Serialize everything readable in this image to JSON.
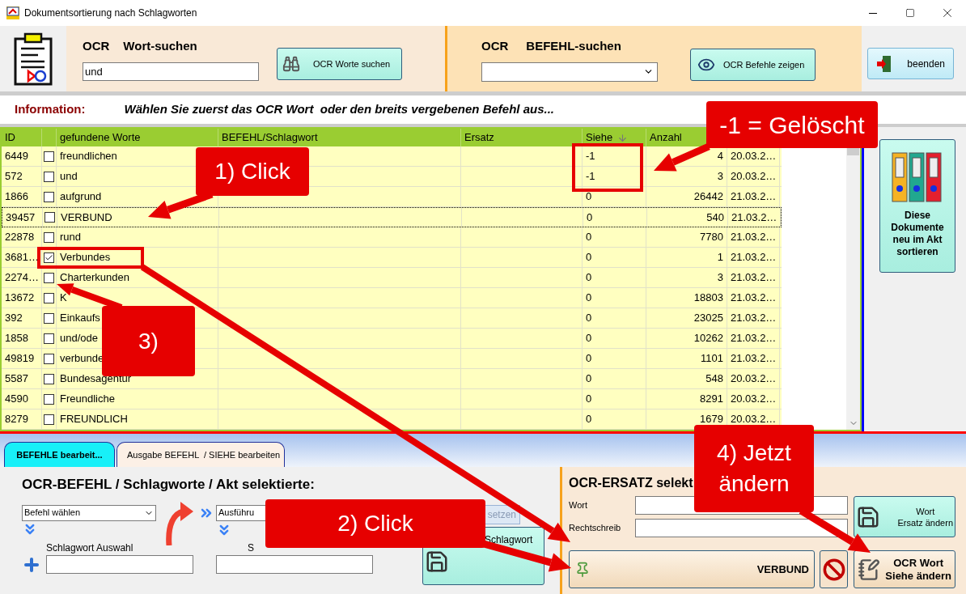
{
  "window": {
    "title": "Dokumentsortierung nach Schlagworten"
  },
  "word_search": {
    "prefix": "OCR",
    "label": "Wort-suchen",
    "value": "und",
    "button": "OCR Worte suchen"
  },
  "command_search": {
    "prefix": "OCR",
    "label": "BEFEHL-suchen",
    "button": "OCR Befehle zeigen"
  },
  "exit_button": "beenden",
  "info": {
    "label": "Information:",
    "message": "Wählen Sie zuerst das OCR Wort  oder den breits vergebenen Befehl aus..."
  },
  "table": {
    "columns": [
      {
        "label": "ID",
        "sorted": false
      },
      {
        "label": "gefundene Worte",
        "sorted": false
      },
      {
        "label": "BEFEHL/Schlagwort",
        "sorted": false
      },
      {
        "label": "Ersatz",
        "sorted": false
      },
      {
        "label": "Siehe",
        "sorted": true
      },
      {
        "label": "Anzahl",
        "sorted": false
      }
    ],
    "rows": [
      {
        "id": "6449",
        "word": "freundlichen",
        "checked": false,
        "selected": false,
        "siehe": "-1",
        "anzahl": "4",
        "date": "20.03.2…"
      },
      {
        "id": "572",
        "word": "und",
        "checked": false,
        "selected": false,
        "siehe": "-1",
        "anzahl": "3",
        "date": "20.03.2…"
      },
      {
        "id": "1866",
        "word": "aufgrund",
        "checked": false,
        "selected": false,
        "siehe": "0",
        "anzahl": "26442",
        "date": "21.03.2…"
      },
      {
        "id": "39457",
        "word": "VERBUND",
        "checked": false,
        "selected": true,
        "siehe": "0",
        "anzahl": "540",
        "date": "21.03.2…"
      },
      {
        "id": "22878",
        "word": "rund",
        "checked": false,
        "selected": false,
        "siehe": "0",
        "anzahl": "7780",
        "date": "21.03.2…"
      },
      {
        "id": "3681…",
        "word": "Verbundes",
        "checked": true,
        "selected": false,
        "siehe": "0",
        "anzahl": "1",
        "date": "21.03.2…"
      },
      {
        "id": "2274…",
        "word": "Charterkunden",
        "checked": false,
        "selected": false,
        "siehe": "0",
        "anzahl": "3",
        "date": "21.03.2…"
      },
      {
        "id": "13672",
        "word": "K",
        "checked": false,
        "selected": false,
        "siehe": "0",
        "anzahl": "18803",
        "date": "21.03.2…"
      },
      {
        "id": "392",
        "word": "Einkaufs",
        "checked": false,
        "selected": false,
        "siehe": "0",
        "anzahl": "23025",
        "date": "21.03.2…"
      },
      {
        "id": "1858",
        "word": "und/ode",
        "checked": false,
        "selected": false,
        "siehe": "0",
        "anzahl": "10262",
        "date": "21.03.2…"
      },
      {
        "id": "49819",
        "word": "verbunde",
        "checked": false,
        "selected": false,
        "siehe": "0",
        "anzahl": "1101",
        "date": "21.03.2…"
      },
      {
        "id": "5587",
        "word": "Bundesagentur",
        "checked": false,
        "selected": false,
        "siehe": "0",
        "anzahl": "548",
        "date": "20.03.2…"
      },
      {
        "id": "4590",
        "word": "Freundliche",
        "checked": false,
        "selected": false,
        "siehe": "0",
        "anzahl": "8291",
        "date": "20.03.2…"
      },
      {
        "id": "8279",
        "word": "FREUNDLICH",
        "checked": false,
        "selected": false,
        "siehe": "0",
        "anzahl": "1679",
        "date": "20.03.2…"
      }
    ]
  },
  "sort_button": "Diese Dokumente neu im Akt sortieren",
  "tabs": [
    {
      "label": "BEFEHLE bearbeit...",
      "selected": true
    },
    {
      "label": "Ausgabe BEFEHL  / SIEHE bearbeiten",
      "selected": false
    }
  ],
  "command_panel": {
    "title": "OCR-BEFEHL / Schlagworte / Akt selektierte:",
    "command_select": "Befehl wählen",
    "keyword_label": "Schlagwort Auswahl",
    "action_select": "Ausführu",
    "action_label": "S",
    "set_button": {
      "label": "setzen",
      "disabled": true
    },
    "add_button": "Schlagwort"
  },
  "replace_panel": {
    "title": "OCR-ERSATZ selekt",
    "fields": [
      {
        "label": "Wort"
      },
      {
        "label": "Rechtschreib"
      }
    ],
    "replace_button": [
      "Wort",
      "Ersatz ändern"
    ],
    "current_word_button": "VERBUND",
    "siehe_button": [
      "OCR Wort",
      "Siehe ändern"
    ]
  },
  "annotations": [
    {
      "lines": [
        "-1 = Gelöscht"
      ]
    },
    {
      "lines": [
        "1) Click"
      ]
    },
    {
      "lines": [
        "3)"
      ]
    },
    {
      "lines": [
        "2) Click"
      ]
    },
    {
      "lines": [
        "4) Jetzt",
        "ändern"
      ]
    }
  ]
}
